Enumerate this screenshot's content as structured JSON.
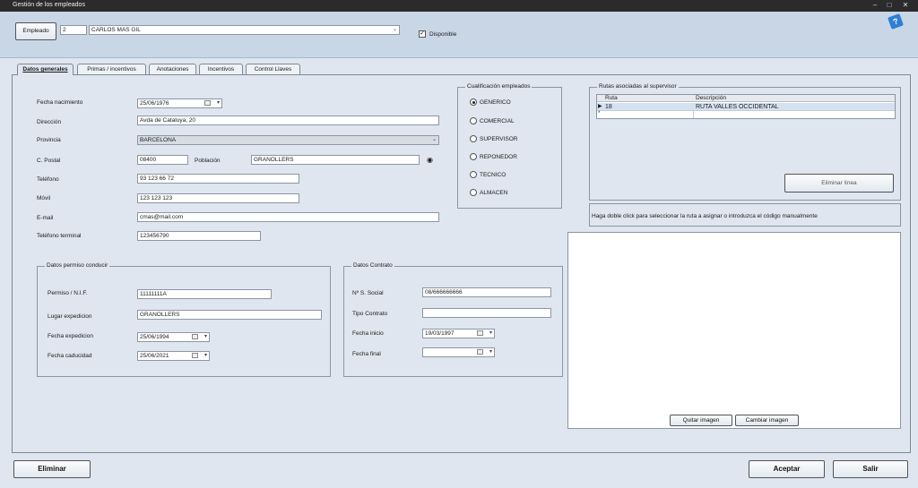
{
  "window": {
    "title": "Gestión de los empleados"
  },
  "header": {
    "employee_button": "Empleado",
    "employee_id": "2",
    "employee_name": "CARLOS MAS GIL",
    "available_label": "Disponible",
    "available_checked": true
  },
  "tabs": [
    {
      "label": "Datos generales",
      "active": true
    },
    {
      "label": "Primas / incentivos",
      "active": false
    },
    {
      "label": "Anotaciones",
      "active": false
    },
    {
      "label": "Incentivos",
      "active": false
    },
    {
      "label": "Control Llaves",
      "active": false
    }
  ],
  "general": {
    "birth_label": "Fecha nacimiento",
    "birth_value": "25/06/1976",
    "address_label": "Dirección",
    "address_value": "Avda de Cataluya, 20",
    "province_label": "Provincia",
    "province_value": "BARCELONA",
    "postal_label": "C. Postal",
    "postal_value": "08400",
    "town_label": "Población",
    "town_value": "GRANOLLERS",
    "phone_label": "Teléfono",
    "phone_value": "93 123 66 72",
    "mobile_label": "Móvil",
    "mobile_value": "123 123 123",
    "email_label": "E-mail",
    "email_value": "cmas@mail.com",
    "terminal_label": "Teléfono terminal",
    "terminal_value": "123456790"
  },
  "permit": {
    "title": "Datos permiso conducir",
    "nif_label": "Permiso / N.I.F.",
    "nif_value": "11111111A",
    "place_label": "Lugar expedicion",
    "place_value": "GRANOLLERS",
    "issue_label": "Fecha expedicion",
    "issue_value": "25/06/1994",
    "expiry_label": "Fecha caducidad",
    "expiry_value": "25/06/2021"
  },
  "contract": {
    "title": "Datos Contrato",
    "ss_label": "Nº S. Social",
    "ss_value": "08/666666666",
    "type_label": "Tipo Contrato",
    "type_value": "",
    "start_label": "Fecha inicio",
    "start_value": "19/03/1997",
    "end_label": "Fecha final",
    "end_value": ""
  },
  "qualification": {
    "title": "Cualificación empleados",
    "options": [
      {
        "label": "GENERICO",
        "selected": true
      },
      {
        "label": "COMERCIAL",
        "selected": false
      },
      {
        "label": "SUPERVISOR",
        "selected": false
      },
      {
        "label": "REPONEDOR",
        "selected": false
      },
      {
        "label": "TECNICO",
        "selected": false
      },
      {
        "label": "ALMACEN",
        "selected": false
      }
    ]
  },
  "routes": {
    "title": "Rutas asociadas al supervisor",
    "columns": [
      "Ruta",
      "Descripción"
    ],
    "rows": [
      {
        "ruta": "18",
        "descripcion": "RUTA VALLES OCCIDENTAL"
      }
    ],
    "delete_line": "Eliminar línea",
    "hint": "Haga doble click para seleccionar la ruta a asignar o introduzca el código manualmente"
  },
  "image": {
    "remove": "Quitar imagen",
    "change": "Cambiar imagen"
  },
  "footer": {
    "delete": "Eliminar",
    "accept": "Aceptar",
    "exit": "Salir"
  }
}
